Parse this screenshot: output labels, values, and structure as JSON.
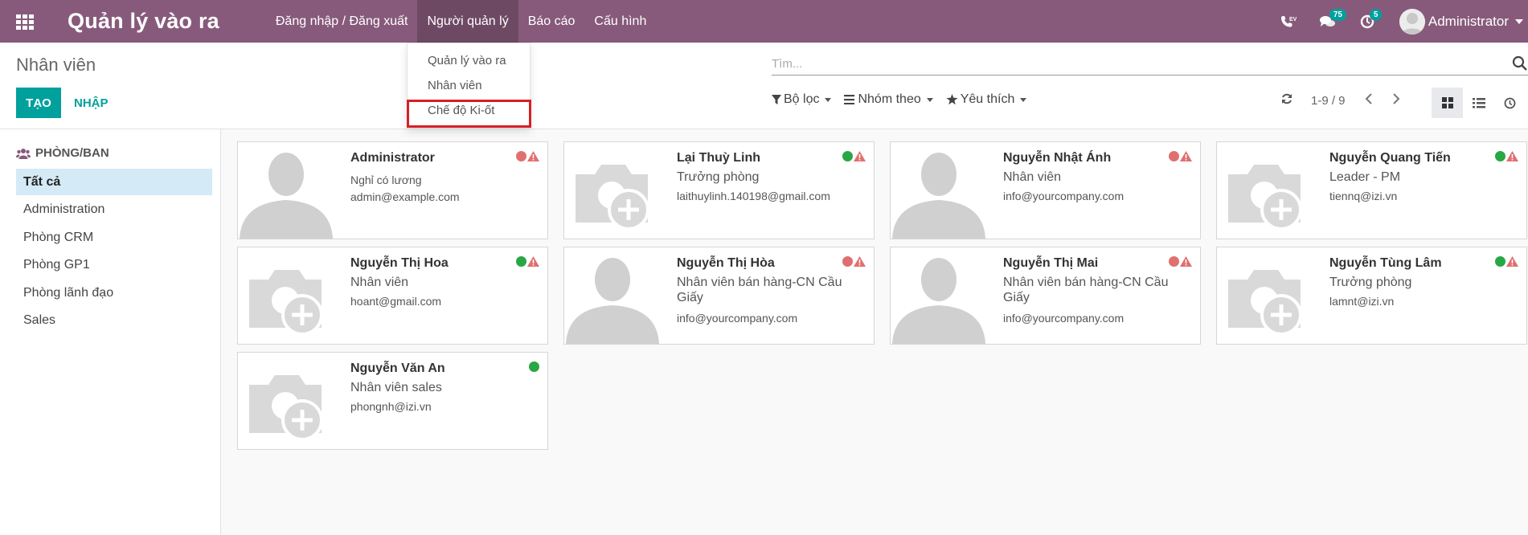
{
  "navbar": {
    "brand": "Quản lý vào ra",
    "menu": [
      {
        "label": "Đăng nhập / Đăng xuất"
      },
      {
        "label": "Người quản lý"
      },
      {
        "label": "Báo cáo"
      },
      {
        "label": "Cấu hình"
      }
    ],
    "phone_icon_label": "EV",
    "messages_count": "75",
    "activities_count": "5",
    "user_name": "Administrator"
  },
  "dropdown": {
    "items": [
      {
        "label": "Quản lý vào ra"
      },
      {
        "label": "Nhân viên"
      },
      {
        "label": "Chế độ Ki-ốt"
      }
    ],
    "highlighted_item": "Chế độ Ki-ốt"
  },
  "control_panel": {
    "title": "Nhân viên",
    "create_label": "TẠO",
    "import_label": "NHẬP",
    "search_placeholder": "Tìm...",
    "filters_label": "Bộ lọc",
    "group_by_label": "Nhóm theo",
    "favorites_label": "Yêu thích",
    "pager": "1-9 / 9"
  },
  "sidebar": {
    "header": "PHÒNG/BAN",
    "items": [
      {
        "label": "Tất cả"
      },
      {
        "label": "Administration"
      },
      {
        "label": "Phòng CRM"
      },
      {
        "label": "Phòng GP1"
      },
      {
        "label": "Phòng lãnh đạo"
      },
      {
        "label": "Sales"
      }
    ]
  },
  "employees": [
    {
      "name": "Administrator",
      "job": "Nghỉ có lương",
      "email": "admin@example.com",
      "status": "red",
      "warning": true,
      "photo": "person"
    },
    {
      "name": "Lại Thuỳ Linh",
      "job": "Trưởng phòng",
      "email": "laithuylinh.140198@gmail.com",
      "status": "green",
      "warning": true,
      "photo": "camera"
    },
    {
      "name": "Nguyễn Nhật Ánh",
      "job": "Nhân viên",
      "email": "info@yourcompany.com",
      "status": "red",
      "warning": true,
      "photo": "person"
    },
    {
      "name": "Nguyễn Quang Tiến",
      "job": "Leader - PM",
      "email": "tiennq@izi.vn",
      "status": "green",
      "warning": true,
      "photo": "camera"
    },
    {
      "name": "Nguyễn Thị Hoa",
      "job": "Nhân viên",
      "email": "hoant@gmail.com",
      "status": "green",
      "warning": true,
      "photo": "camera"
    },
    {
      "name": "Nguyễn Thị Hòa",
      "job": "Nhân viên bán hàng-CN Cầu Giấy",
      "email": "info@yourcompany.com",
      "status": "red",
      "warning": true,
      "photo": "person"
    },
    {
      "name": "Nguyễn Thị Mai",
      "job": "Nhân viên bán hàng-CN Cầu Giấy",
      "email": "info@yourcompany.com",
      "status": "red",
      "warning": true,
      "photo": "person"
    },
    {
      "name": "Nguyễn Tùng Lâm",
      "job": "Trưởng phòng",
      "email": "lamnt@izi.vn",
      "status": "green",
      "warning": true,
      "photo": "camera"
    },
    {
      "name": "Nguyễn Văn An",
      "job": "Nhân viên sales",
      "email": "phongnh@izi.vn",
      "status": "green",
      "warning": false,
      "photo": "camera"
    }
  ],
  "colors": {
    "brand": "#875a7b",
    "accent": "#00a09d",
    "status_green": "#28a745",
    "status_red": "#e06f6f",
    "warning": "#e06f6f"
  }
}
